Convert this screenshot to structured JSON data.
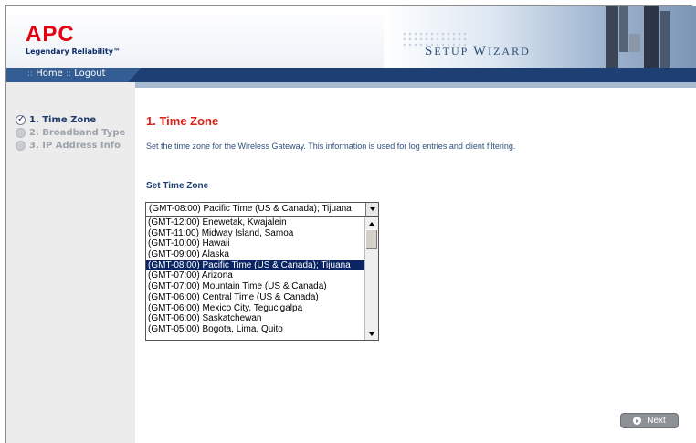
{
  "brand": {
    "name": "APC",
    "tagline": "Legendary Reliability",
    "trademark": "™"
  },
  "banner": {
    "title_prefix": "S",
    "title_rest": "ETUP ",
    "title_prefix2": "W",
    "title_rest2": "IZARD"
  },
  "nav": {
    "sep": "::",
    "home": "Home",
    "logout": "Logout"
  },
  "steps": [
    {
      "label": "1. Time Zone",
      "state": "current"
    },
    {
      "label": "2. Broadband Type",
      "state": "pending"
    },
    {
      "label": "3. IP Address Info",
      "state": "pending"
    }
  ],
  "main": {
    "title": "1. Time Zone",
    "description": "Set the time zone for the Wireless Gateway. This information is used for log entries and client filtering.",
    "field_label": "Set Time Zone",
    "selected": "(GMT-08:00) Pacific Time (US & Canada); Tijuana",
    "options": [
      "(GMT-12:00) Enewetak, Kwajalein",
      "(GMT-11:00) Midway Island, Samoa",
      "(GMT-10:00) Hawaii",
      "(GMT-09:00) Alaska",
      "(GMT-08:00) Pacific Time (US & Canada); Tijuana",
      "(GMT-07:00) Arizona",
      "(GMT-07:00) Mountain Time (US & Canada)",
      "(GMT-06:00) Central Time (US & Canada)",
      "(GMT-06:00) Mexico City, Tegucigalpa",
      "(GMT-06:00) Saskatchewan",
      "(GMT-05:00) Bogota, Lima, Quito"
    ],
    "selected_index": 4,
    "next_label": "Next"
  },
  "colors": {
    "brand_red": "#e60012",
    "nav_blue": "#1d3f73",
    "title_red": "#dc1f14",
    "selection": "#0b2463"
  }
}
